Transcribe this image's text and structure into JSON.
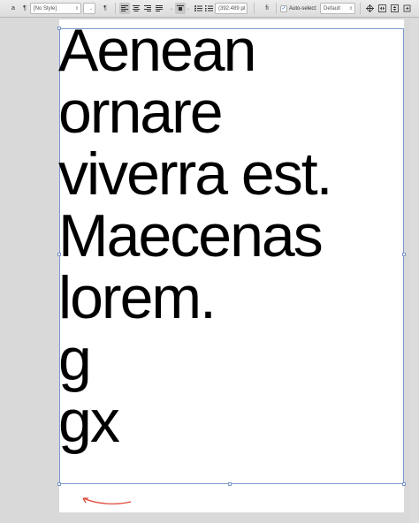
{
  "toolbar": {
    "char_icon": "a",
    "para_icon": "¶",
    "style_field": "[No Style]",
    "para_icon2": "¶",
    "position_field": "(392.489 pt",
    "fi_label": "fi",
    "auto_select_label": "Auto-select:",
    "auto_select_value": "Default"
  },
  "document": {
    "lines": [
      "Aenean",
      "ornare",
      "viverra est.",
      "Maecenas",
      "lorem.",
      "g",
      "gx"
    ]
  },
  "colors": {
    "selection": "#7d98c9",
    "annotation_arrow": "#e04a3a"
  }
}
